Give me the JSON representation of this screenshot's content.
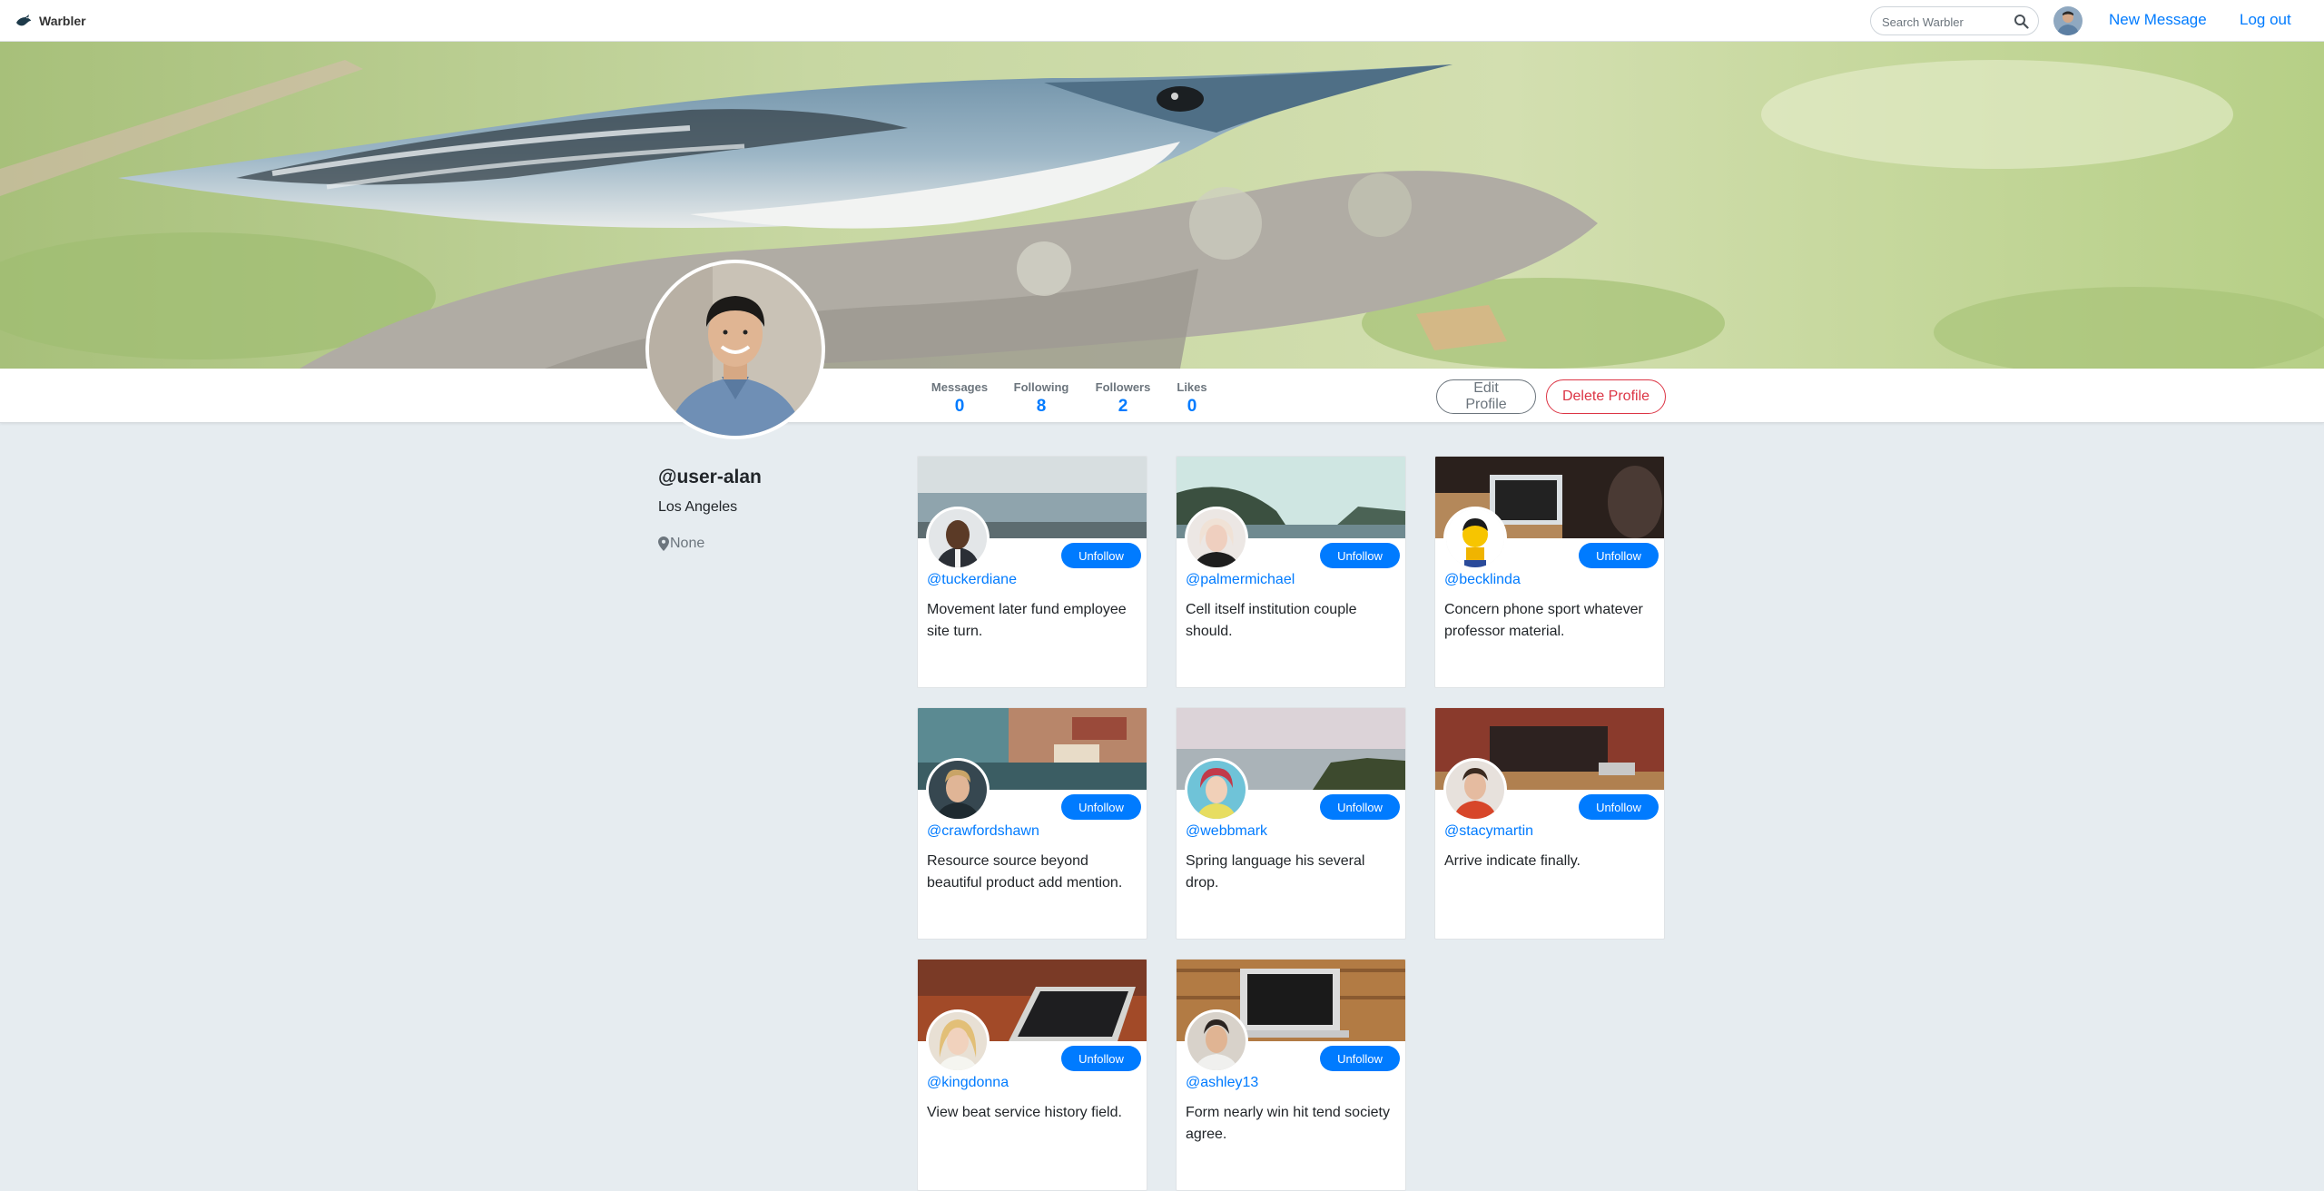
{
  "navbar": {
    "brand": "Warbler",
    "search_placeholder": "Search Warbler",
    "new_message": "New Message",
    "logout": "Log out"
  },
  "profile": {
    "username": "@user-alan",
    "location": "Los Angeles",
    "bio": "None",
    "stats": [
      {
        "label": "Messages",
        "value": "0"
      },
      {
        "label": "Following",
        "value": "8"
      },
      {
        "label": "Followers",
        "value": "2"
      },
      {
        "label": "Likes",
        "value": "0"
      }
    ],
    "edit_label": "Edit Profile",
    "delete_label": "Delete Profile"
  },
  "following": [
    {
      "handle": "@tuckerdiane",
      "bio": "Movement later fund employee site turn.",
      "button": "Unfollow"
    },
    {
      "handle": "@palmermichael",
      "bio": "Cell itself institution couple should.",
      "button": "Unfollow"
    },
    {
      "handle": "@becklinda",
      "bio": "Concern phone sport whatever professor material.",
      "button": "Unfollow"
    },
    {
      "handle": "@crawfordshawn",
      "bio": "Resource source beyond beautiful product add mention.",
      "button": "Unfollow"
    },
    {
      "handle": "@webbmark",
      "bio": "Spring language his several drop.",
      "button": "Unfollow"
    },
    {
      "handle": "@stacymartin",
      "bio": "Arrive indicate finally.",
      "button": "Unfollow"
    },
    {
      "handle": "@kingdonna",
      "bio": "View beat service history field.",
      "button": "Unfollow"
    },
    {
      "handle": "@ashley13",
      "bio": "Form nearly win hit tend society agree.",
      "button": "Unfollow"
    }
  ],
  "colors": {
    "accent": "#007bff",
    "danger": "#dc3545",
    "background": "#e6ecf0"
  }
}
